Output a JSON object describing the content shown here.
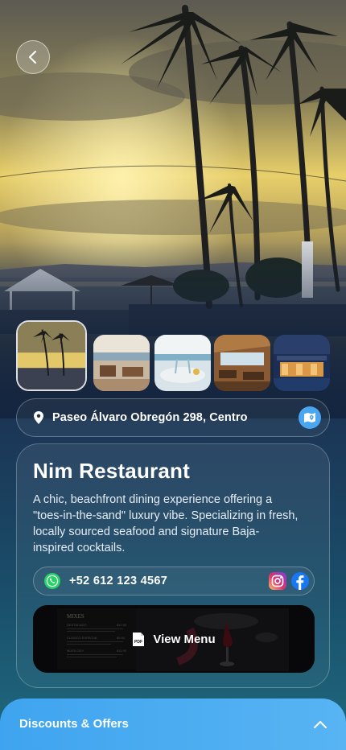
{
  "restaurant": {
    "name": "Nim Restaurant",
    "description": "A chic, beachfront dining experience offering a \"toes-in-the-sand\" luxury vibe. Specializing in fresh, locally sourced seafood and signature Baja-inspired cocktails."
  },
  "location": {
    "address": "Paseo Álvaro Obregón 298, Centro"
  },
  "contact": {
    "phone": "+52 612 123 4567"
  },
  "menu": {
    "label": "View Menu",
    "file_badge": "PDF",
    "preview": {
      "heading": "MIXES",
      "items": [
        {
          "name": "DESTACADO",
          "price": "$10.90"
        },
        {
          "name": "CLÁSICO ESPECIAL",
          "price": "$9.90"
        },
        {
          "name": "MIXOLOGY",
          "price": "$11.90"
        }
      ]
    }
  },
  "offers": {
    "label": "Discounts & Offers"
  },
  "gallery": {
    "active_index": 0,
    "count": 5
  },
  "colors": {
    "accent": "#4aa6f0",
    "offers_bar": "#45a8f1",
    "whatsapp": "#25d366"
  },
  "icons": {
    "back": "chevron-left-icon",
    "location": "location-pin-icon",
    "map": "map-icon",
    "whatsapp": "whatsapp-icon",
    "instagram": "instagram-icon",
    "facebook": "facebook-icon",
    "pdf": "pdf-file-icon",
    "offers_toggle": "chevron-up-icon"
  }
}
